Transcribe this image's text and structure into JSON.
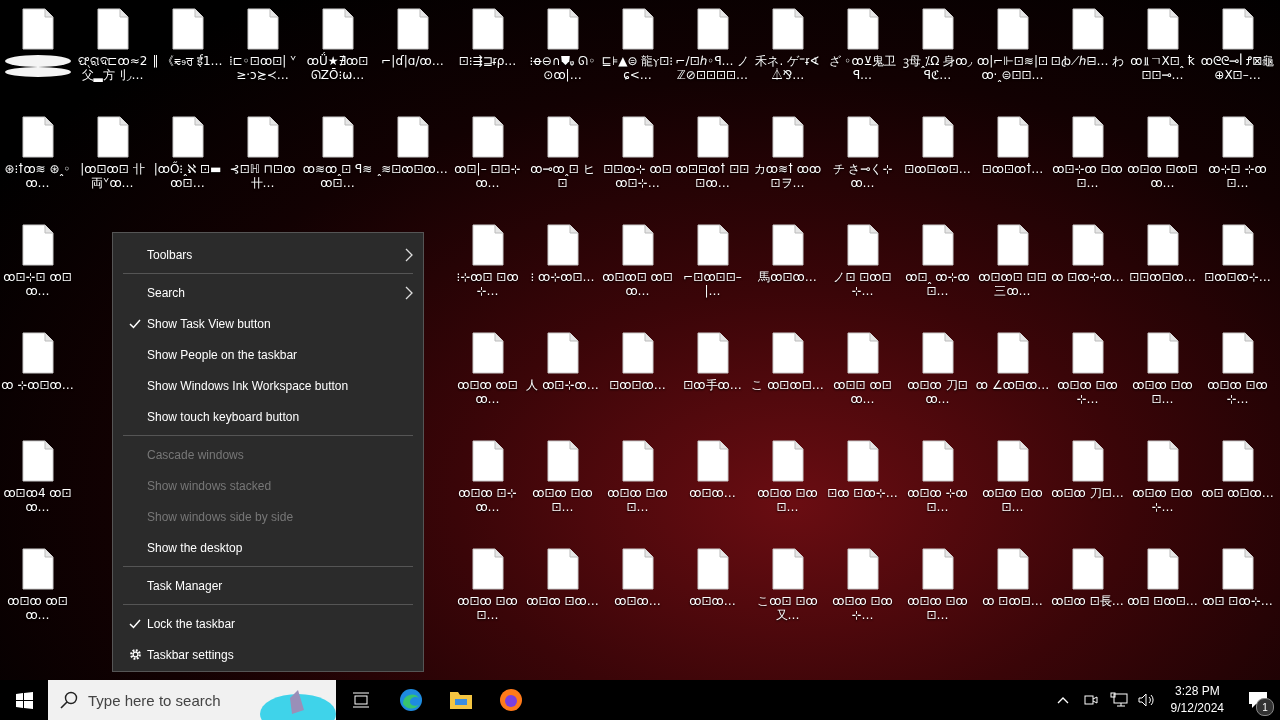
{
  "desktop": {
    "rows": [
      [
        {
          "redacted": true
        },
        {
          "label": "ଫ୍ରାଦ⊏ꝏ≈2父▂方刂◞…"
        },
        {
          "label": "‖ 《⩳₉ਰ ई1…"
        },
        {
          "label": "⁞⊏◦⊡ꝏ⊡| ᘁ≥·ɔ≿≺…"
        },
        {
          "label": "ꝏǗ★∄ꝏ⊡ ᘏΖŌ⁝ω…"
        },
        {
          "label": "⌐|ɗ|ɑ/ꝏ…"
        },
        {
          "label": "⊡⁝⇶⊒ᵲρ…"
        },
        {
          "label": "⁝ꝋ⊖∩⛊ᵩ ᘏ◦⊙ꝏ|…"
        },
        {
          "label": "⊑⊧▲⊜ 龍ⲩ⊡⁝ɕ<…"
        },
        {
          "label": "⌐∕⊡ℎ◦ꟼ… ノℤ⊘⊡⊡⊡⊡…"
        },
        {
          "label": "禾ネ. ゲ⁼ᵲ∢⏃⅋…"
        },
        {
          "label": "ざ ◦ꝏ⊻鬼卫ꟼ…"
        },
        {
          "label": "ꝫ母ꞈ⁒Ω 身ꝏ◞ꟼℭ…"
        },
        {
          "label": "ꝏ|⌐⊩⊡≋|⊡ ꝏ·ꞈ⊜⊡⊡…"
        },
        {
          "label": "⊡ꞗ⟋ℎ⊟… わ"
        },
        {
          "label": "ꝏ⫫ㄱX⊡ꞈ ꝁ⊡⊡⊸…"
        },
        {
          "label": "ꝏᘓᘓ⊸ꟾ Ꝭ⊠龜⊕X⊡–…"
        }
      ],
      [
        {
          "label": "⊛⁝ꝉꝏ≋ ⊛ꞈ◦ꝏ…"
        },
        {
          "label": "|ꝏ⊡ꝏ⊡ 卝両ᘁꝏ…"
        },
        {
          "label": "|ꝏŐ⁝ꞈℵ ⊡▬ꝏ⊡…"
        },
        {
          "label": "⊰⊡ℍ ⊓⊡ꝏ卄…"
        },
        {
          "label": "ꝏ≋ꝏꞈ⊡ ꟼ≋ꝏ⊡…"
        },
        {
          "label": "ꞈ≋⊡ꝏ⊡ꝏ…"
        },
        {
          "label": "ꝏ⊡|– ⊡⊡⊹ꝏ…"
        },
        {
          "label": "ꝏ⊸ꝏꞈ⊡ ヒ⊡"
        },
        {
          "label": "⊡⊡ꝏ⊹ ꝏ⊡ꝏ⊡⊹…"
        },
        {
          "label": "ꝏ⊡⊡ꝏꝉ ⊡⊡⊡ꝏ…"
        },
        {
          "label": "カꝏ≋ꝉ ꝏꝏ⊡ヲ…"
        },
        {
          "label": "チ さ⊸く⊹ꝏ…"
        },
        {
          "label": "⊡ꝏ⊡ꝏ⊡…"
        },
        {
          "label": "⊡ꝏ⊡ꝏꝉ…"
        },
        {
          "label": "ꝏ⊡⊹ꝏ ⊡ꝏ⊡…"
        },
        {
          "label": "ꝏ⊡ꝏ ⊡ꝏ⊡ꝏ…"
        },
        {
          "label": "ꝏ⊹⊡ ⊹ꝏ⊡…"
        }
      ],
      [
        {
          "label": "ꝏ⊡⊹⊡ ꝏ⊡ꝏ…"
        },
        null,
        null,
        null,
        null,
        null,
        {
          "label": "⁝⊹ꝏ⊡ ⊡ꝏ⊹…"
        },
        {
          "label": "⁝ ꝏ⊹ꝏ⊡…"
        },
        {
          "label": "ꝏ⊡ꝏ⊡ ꝏ⊡ꝏ…"
        },
        {
          "label": "⌐⊡ꝏ⊡⊡–|…"
        },
        {
          "label": "馬ꝏ⊡ꝏ…"
        },
        {
          "label": "ノ⊡ ⊡ꝏ⊡⊹…"
        },
        {
          "label": "ꝏ⊡ꞈ ꝏ⊹ꝏ⊡…"
        },
        {
          "label": "ꝏ⊡ꝏ⊡ ⊡⊡三ꝏ…"
        },
        {
          "label": "ꝏ ⊡ꝏ⊹ꝏ…"
        },
        {
          "label": "⊡⊡ꝏ⊡ꝏ…"
        },
        {
          "label": "⊡ꝏ⊡ꝏ⊹…"
        }
      ],
      [
        {
          "label": "ꝏ ⊹ꝏ⊡ꝏ…"
        },
        null,
        null,
        null,
        null,
        null,
        {
          "label": "ꝏ⊡ꝏ ꝏ⊡ꝏ…"
        },
        {
          "label": "人 ꝏ⊡⊹ꝏ…"
        },
        {
          "label": "⊡ꝏ⊡ꝏ…"
        },
        {
          "label": "⊡ꝏ手ꝏ…"
        },
        {
          "label": "こ ꝏ⊡ꝏ⊡…"
        },
        {
          "label": "ꝏ⊡⊡ ꝏ⊡ꝏ…"
        },
        {
          "label": "ꝏ⊡ꝏ 刀⊡ꝏ…"
        },
        {
          "label": "ꝏ ∠ꝏ⊡ꝏ…"
        },
        {
          "label": "ꝏ⊡ꝏ ⊡ꝏ⊹…"
        },
        {
          "label": "ꝏ⊡ꝏ ⊡ꝏ⊡…"
        },
        {
          "label": "ꝏ⊡ꝏ ⊡ꝏ⊹…"
        }
      ],
      [
        {
          "label": "ꝏ⊡ꝏ4 ꝏ⊡ꝏ…"
        },
        null,
        null,
        null,
        null,
        null,
        {
          "label": "ꝏ⊡ꝏ ⊡⊹ꝏ…"
        },
        {
          "label": "ꝏ⊡ꝏ ⊡ꝏ⊡…"
        },
        {
          "label": "ꝏ⊡ꝏ ⊡ꝏ⊡…"
        },
        {
          "label": "ꝏ⊡ꝏ…"
        },
        {
          "label": "ꝏ⊡ꝏ ⊡ꝏ⊡…"
        },
        {
          "label": "⊡ꝏ ⊡ꝏ⊹…"
        },
        {
          "label": "ꝏ⊡ꝏ ⊹ꝏ⊡…"
        },
        {
          "label": "ꝏ⊡ꝏ ⊡ꝏ⊡…"
        },
        {
          "label": "ꝏ⊡ꝏ 刀⊡…"
        },
        {
          "label": "ꝏ⊡ꝏ ⊡ꝏ⊹…"
        },
        {
          "label": "ꝏ⊡ ꝏ⊡ꝏ…"
        }
      ],
      [
        {
          "label": "ꝏ⊡ꝏ ꝏ⊡ꝏ…"
        },
        null,
        null,
        null,
        null,
        null,
        {
          "label": "ꝏ⊡ꝏ ⊡ꝏ⊡…"
        },
        {
          "label": "ꝏ⊡ꝏ ⊡ꝏ…"
        },
        {
          "label": "ꝏ⊡ꝏ…"
        },
        {
          "label": "ꝏ⊡ꝏ…"
        },
        {
          "label": "こꝏ⊡ ⊡ꝏ又…"
        },
        {
          "label": "ꝏ⊡ꝏ ⊡ꝏ⊹…"
        },
        {
          "label": "ꝏ⊡ꝏ ⊡ꝏ⊡…"
        },
        {
          "label": "ꝏ ⊡ꝏ⊡…"
        },
        {
          "label": "ꝏ⊡ꝏ ⊡長…"
        },
        {
          "label": "ꝏ⊡ ⊡ꝏ⊡…"
        },
        {
          "label": "ꝏ⊡ ⊡ꝏ⊹…"
        }
      ]
    ]
  },
  "context_menu": {
    "items": [
      {
        "kind": "submenu",
        "label": "Toolbars"
      },
      {
        "kind": "divider"
      },
      {
        "kind": "submenu",
        "label": "Search"
      },
      {
        "kind": "toggle",
        "label": "Show Task View button",
        "checked": true,
        "disabled": false
      },
      {
        "kind": "toggle",
        "label": "Show People on the taskbar",
        "checked": false,
        "disabled": false
      },
      {
        "kind": "toggle",
        "label": "Show Windows Ink Workspace button",
        "checked": false,
        "disabled": false
      },
      {
        "kind": "toggle",
        "label": "Show touch keyboard button",
        "checked": false,
        "disabled": false
      },
      {
        "kind": "divider"
      },
      {
        "kind": "toggle",
        "label": "Cascade windows",
        "checked": false,
        "disabled": true
      },
      {
        "kind": "toggle",
        "label": "Show windows stacked",
        "checked": false,
        "disabled": true
      },
      {
        "kind": "toggle",
        "label": "Show windows side by side",
        "checked": false,
        "disabled": true
      },
      {
        "kind": "toggle",
        "label": "Show the desktop",
        "checked": false,
        "disabled": false
      },
      {
        "kind": "divider"
      },
      {
        "kind": "toggle",
        "label": "Task Manager",
        "checked": false,
        "disabled": false
      },
      {
        "kind": "divider"
      },
      {
        "kind": "toggle",
        "label": "Lock the taskbar",
        "checked": true,
        "disabled": false
      },
      {
        "kind": "settings",
        "label": "Taskbar settings"
      }
    ]
  },
  "taskbar": {
    "search": {
      "placeholder": "Type here to search"
    },
    "clock": {
      "time": "3:28 PM",
      "date": "9/12/2024"
    },
    "notifications": {
      "count": "1"
    }
  }
}
